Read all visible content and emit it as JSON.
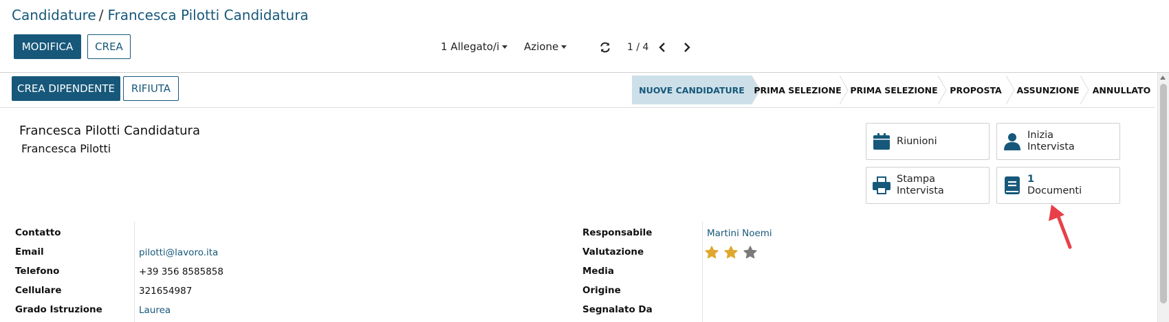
{
  "breadcrumb": {
    "parent": "Candidature",
    "separator": "/",
    "current": "Francesca Pilotti Candidatura"
  },
  "control_panel": {
    "edit_label": "MODIFICA",
    "create_label": "CREA",
    "attachments_label": "1 Allegato/i",
    "action_label": "Azione",
    "pager_value": "1 / 4"
  },
  "status_bar": {
    "create_employee_label": "CREA DIPENDENTE",
    "refuse_label": "RIFIUTA",
    "stages": [
      "NUOVE CANDIDATURE",
      "PRIMA SELEZIONE",
      "PRIMA SELEZIONE",
      "PROPOSTA",
      "ASSUNZIONE",
      "ANNULLATO"
    ],
    "active_stage": "NUOVE CANDIDATURE"
  },
  "form": {
    "title": "Francesca Pilotti Candidatura",
    "partner_name": "Francesca Pilotti"
  },
  "smart_buttons": {
    "meetings": {
      "label": "Riunioni",
      "icon": "calendar-icon"
    },
    "start_interview": {
      "line1": "Inizia",
      "line2": "Intervista",
      "icon": "user-icon"
    },
    "print_interview": {
      "line1": "Stampa",
      "line2": "Intervista",
      "icon": "printer-icon"
    },
    "documents": {
      "count": "1",
      "label": "Documenti",
      "icon": "book-icon"
    }
  },
  "left_fields": [
    {
      "label": "Contatto",
      "value": ""
    },
    {
      "label": "Email",
      "value": "pilotti@lavoro.ita"
    },
    {
      "label": "Telefono",
      "value": "+39 356 8585858"
    },
    {
      "label": "Cellulare",
      "value": "321654987"
    },
    {
      "label": "Grado Istruzione",
      "value": "Laurea"
    }
  ],
  "right_fields": [
    {
      "label": "Responsabile",
      "value": "Martini Noemi"
    },
    {
      "label": "Valutazione",
      "value": ""
    },
    {
      "label": "Media",
      "value": ""
    },
    {
      "label": "Origine",
      "value": ""
    },
    {
      "label": "Segnalato Da",
      "value": ""
    }
  ],
  "rating": {
    "filled": 2,
    "max": 3
  },
  "colors": {
    "primary": "#17587a",
    "active_stage_bg": "#cde0e9",
    "star_filled": "#e0a82e",
    "star_empty": "#7a7a7a",
    "annotation_arrow": "#e8404a"
  }
}
